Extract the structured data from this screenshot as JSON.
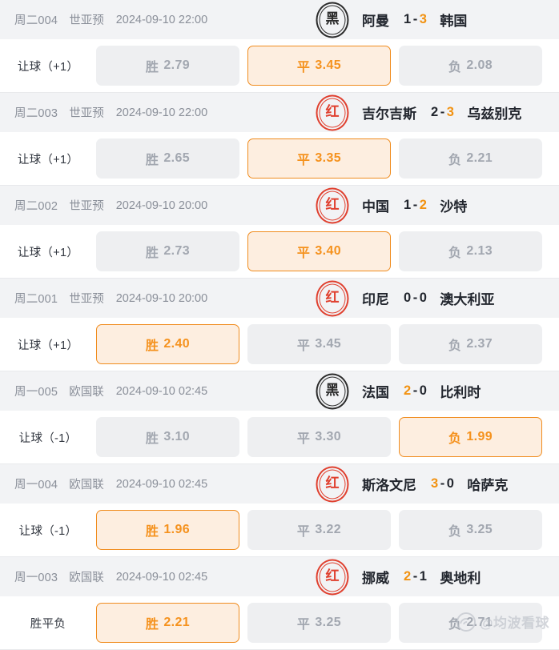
{
  "watermark": {
    "text": "@均波看球",
    "icon": "weibo-icon"
  },
  "labels": {
    "win": "胜",
    "draw": "平",
    "lose": "负"
  },
  "matches": [
    {
      "id": "周二004",
      "league": "世亚预",
      "time": "2024-09-10 22:00",
      "seal": {
        "char": "黑",
        "color": "#2b2b2b",
        "type": "black"
      },
      "home": "阿曼",
      "away": "韩国",
      "home_score": "1",
      "away_score": "3",
      "dash": "-",
      "winner": "away",
      "handicap": "让球（+1）",
      "odds": [
        {
          "label": "胜",
          "value": "2.79",
          "selected": false
        },
        {
          "label": "平",
          "value": "3.45",
          "selected": true
        },
        {
          "label": "负",
          "value": "2.08",
          "selected": false
        }
      ]
    },
    {
      "id": "周二003",
      "league": "世亚预",
      "time": "2024-09-10 22:00",
      "seal": {
        "char": "红",
        "color": "#e0402f",
        "type": "red"
      },
      "home": "吉尔吉斯",
      "away": "乌兹别克",
      "home_score": "2",
      "away_score": "3",
      "dash": "-",
      "winner": "away",
      "handicap": "让球（+1）",
      "odds": [
        {
          "label": "胜",
          "value": "2.65",
          "selected": false
        },
        {
          "label": "平",
          "value": "3.35",
          "selected": true
        },
        {
          "label": "负",
          "value": "2.21",
          "selected": false
        }
      ]
    },
    {
      "id": "周二002",
      "league": "世亚预",
      "time": "2024-09-10 20:00",
      "seal": {
        "char": "红",
        "color": "#e0402f",
        "type": "red"
      },
      "home": "中国",
      "away": "沙特",
      "home_score": "1",
      "away_score": "2",
      "dash": "-",
      "winner": "away",
      "handicap": "让球（+1）",
      "odds": [
        {
          "label": "胜",
          "value": "2.73",
          "selected": false
        },
        {
          "label": "平",
          "value": "3.40",
          "selected": true
        },
        {
          "label": "负",
          "value": "2.13",
          "selected": false
        }
      ]
    },
    {
      "id": "周二001",
      "league": "世亚预",
      "time": "2024-09-10 20:00",
      "seal": {
        "char": "红",
        "color": "#e0402f",
        "type": "red"
      },
      "home": "印尼",
      "away": "澳大利亚",
      "home_score": "0",
      "away_score": "0",
      "dash": "-",
      "winner": "none",
      "handicap": "让球（+1）",
      "odds": [
        {
          "label": "胜",
          "value": "2.40",
          "selected": true
        },
        {
          "label": "平",
          "value": "3.45",
          "selected": false
        },
        {
          "label": "负",
          "value": "2.37",
          "selected": false
        }
      ]
    },
    {
      "id": "周一005",
      "league": "欧国联",
      "time": "2024-09-10 02:45",
      "seal": {
        "char": "黑",
        "color": "#2b2b2b",
        "type": "black"
      },
      "home": "法国",
      "away": "比利时",
      "home_score": "2",
      "away_score": "0",
      "dash": "-",
      "winner": "home",
      "handicap": "让球（-1）",
      "odds": [
        {
          "label": "胜",
          "value": "3.10",
          "selected": false
        },
        {
          "label": "平",
          "value": "3.30",
          "selected": false
        },
        {
          "label": "负",
          "value": "1.99",
          "selected": true
        }
      ]
    },
    {
      "id": "周一004",
      "league": "欧国联",
      "time": "2024-09-10 02:45",
      "seal": {
        "char": "红",
        "color": "#e0402f",
        "type": "red"
      },
      "home": "斯洛文尼",
      "away": "哈萨克",
      "home_score": "3",
      "away_score": "0",
      "dash": "-",
      "winner": "home",
      "handicap": "让球（-1）",
      "odds": [
        {
          "label": "胜",
          "value": "1.96",
          "selected": true
        },
        {
          "label": "平",
          "value": "3.22",
          "selected": false
        },
        {
          "label": "负",
          "value": "3.25",
          "selected": false
        }
      ]
    },
    {
      "id": "周一003",
      "league": "欧国联",
      "time": "2024-09-10 02:45",
      "seal": {
        "char": "红",
        "color": "#e0402f",
        "type": "red"
      },
      "home": "挪威",
      "away": "奥地利",
      "home_score": "2",
      "away_score": "1",
      "dash": "-",
      "winner": "home",
      "handicap": "胜平负",
      "odds": [
        {
          "label": "胜",
          "value": "2.21",
          "selected": true
        },
        {
          "label": "平",
          "value": "3.25",
          "selected": false
        },
        {
          "label": "负",
          "value": "2.71",
          "selected": false
        }
      ]
    }
  ]
}
